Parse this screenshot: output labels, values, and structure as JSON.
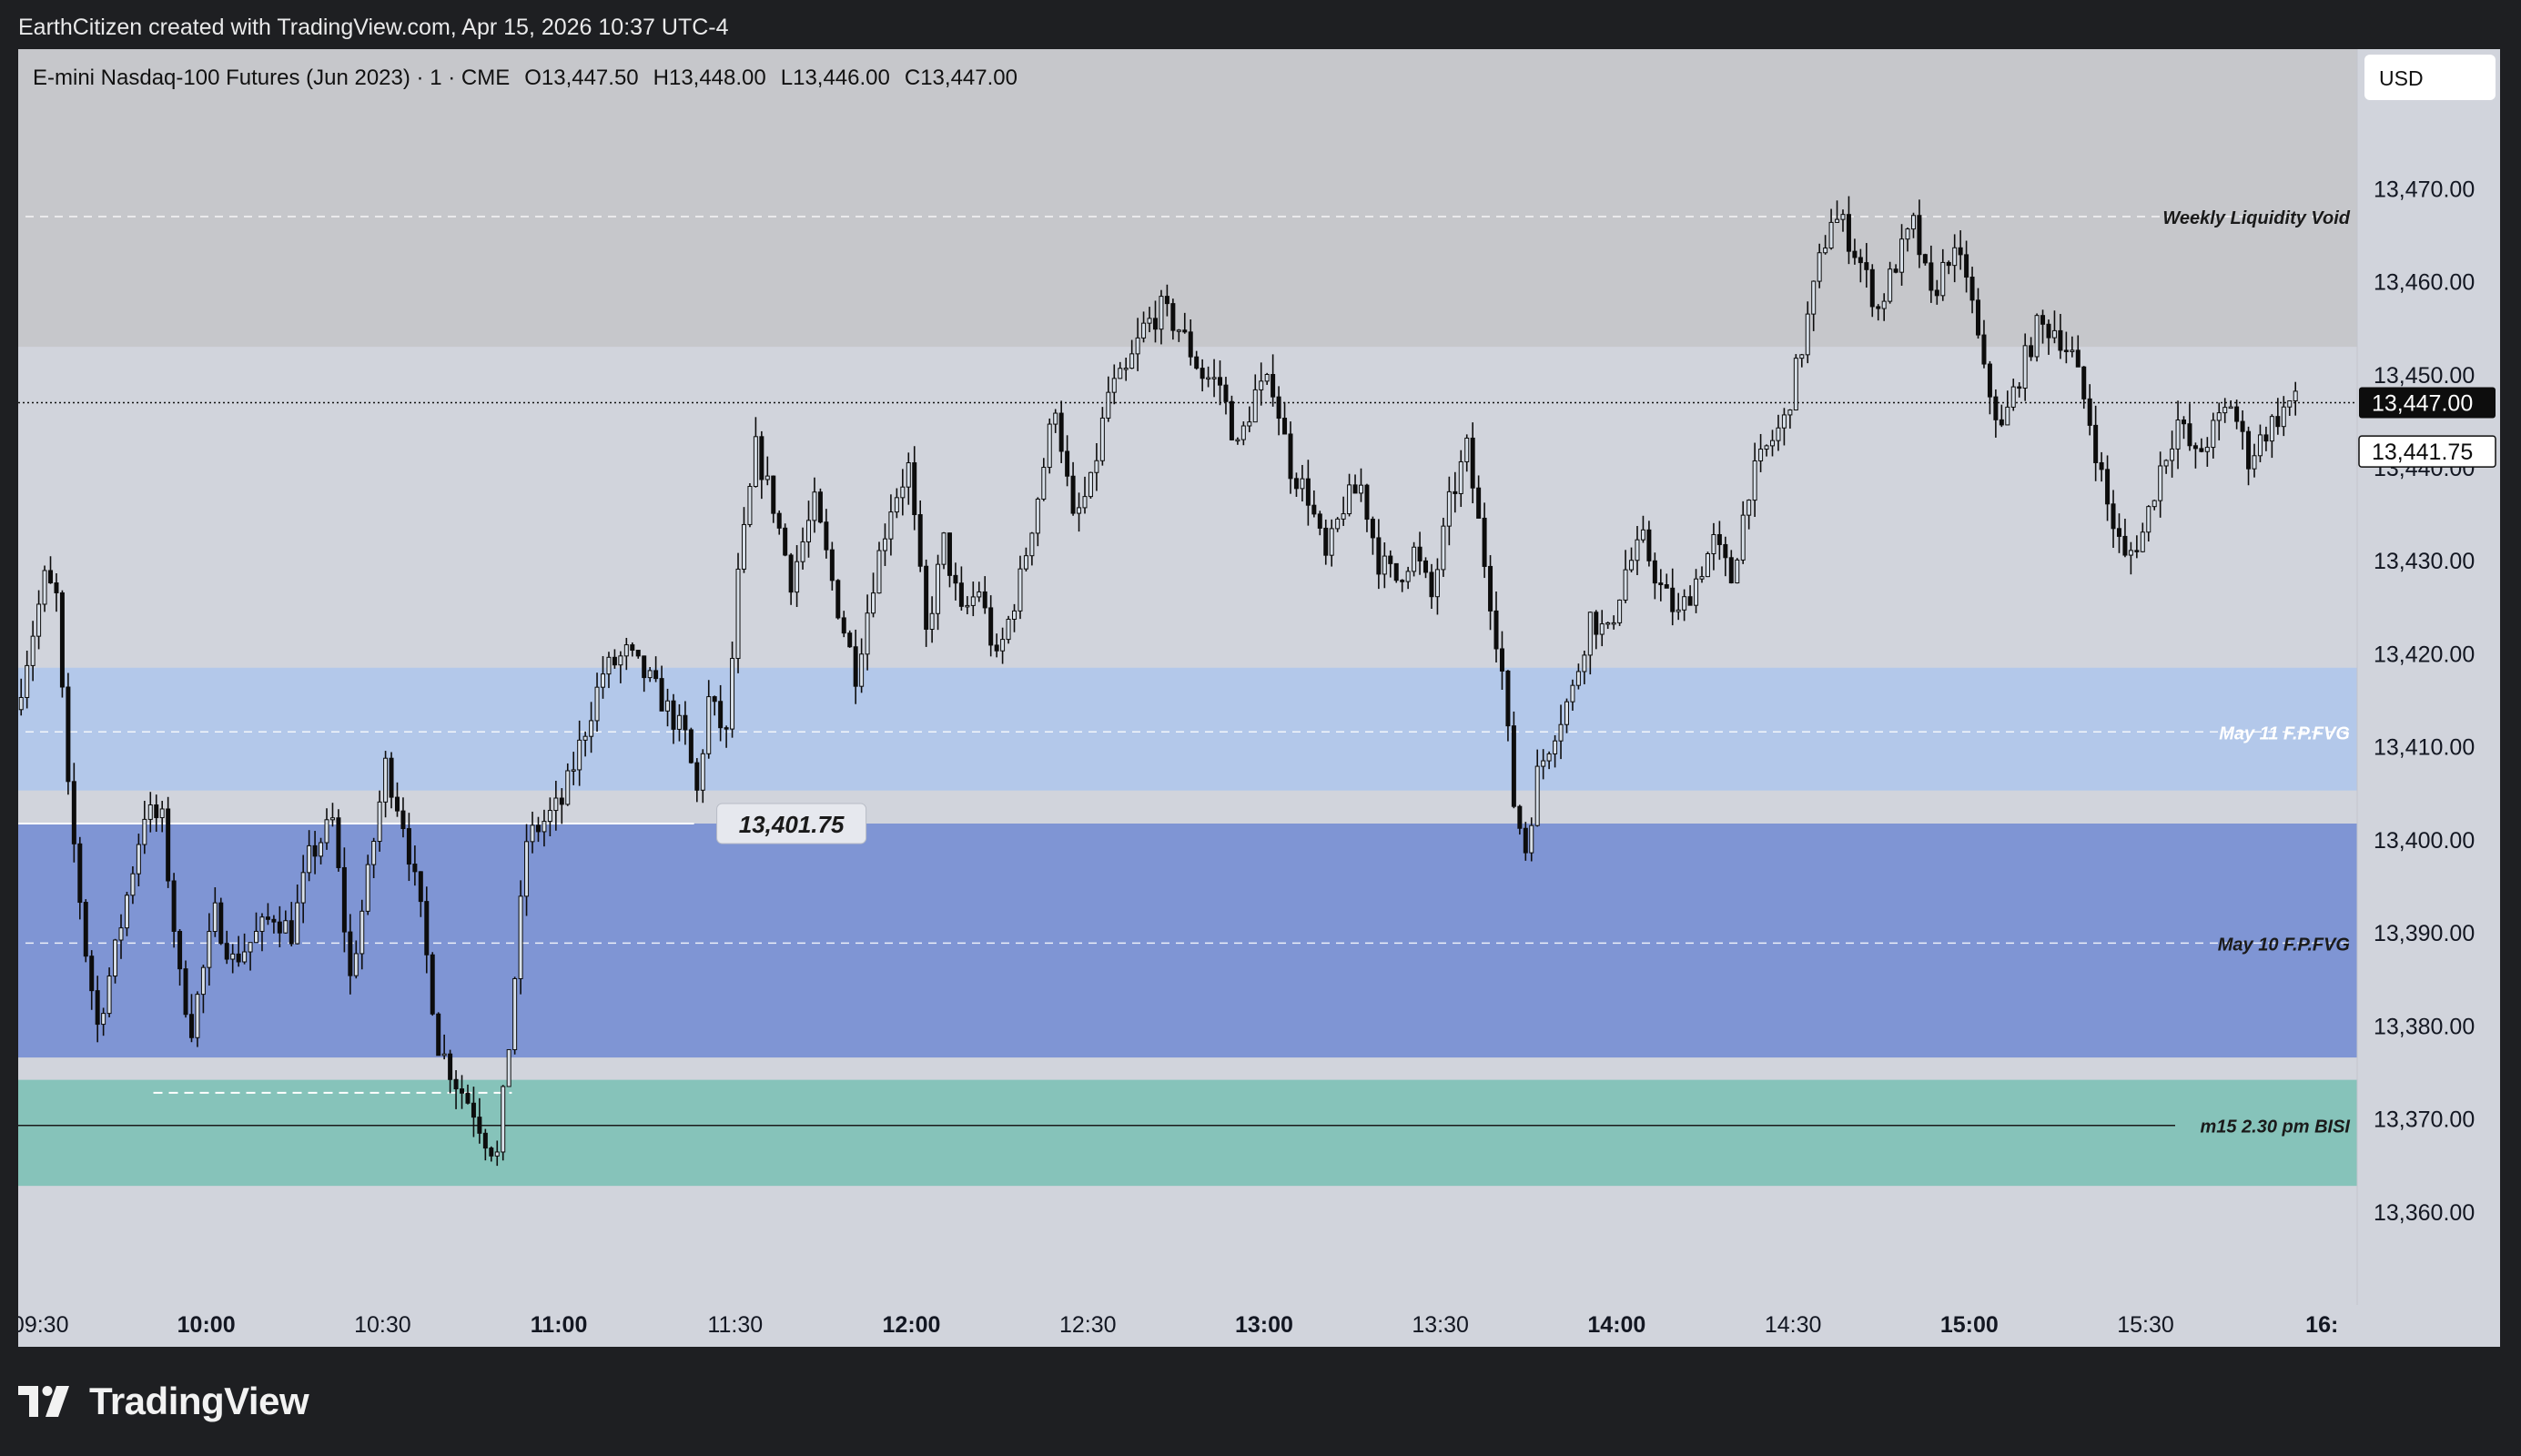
{
  "header": {
    "attribution": "EarthCitizen created with TradingView.com, Apr 15, 2026 10:37 UTC-4"
  },
  "currency_button": {
    "label": "USD"
  },
  "branding": {
    "logo_text": "TradingView",
    "logo_icon": "tradingview-logo-icon"
  },
  "colors": {
    "background": "#d1d4dc",
    "weekly_void_zone": "#c6c7cb",
    "may11_zone": "#b3c8ea",
    "may10_zone": "#7f95d4",
    "bisi_zone": "#86c3ba",
    "candle_up_body": "#d8e0e9",
    "candle_down_body": "#0d0d0d",
    "wick": "#0d0d0d"
  },
  "chart_data": {
    "type": "candlestick",
    "title": "E-mini Nasdaq-100 Futures (Jun 2023) · 1 · CME",
    "ohlc": {
      "O": "O13,447.50",
      "H": "H13,448.00",
      "L": "L13,446.00",
      "C": "C13,447.00"
    },
    "ylim": [
      13350,
      13485
    ],
    "y_ticks": [
      13360,
      13370,
      13380,
      13390,
      13400,
      13410,
      13420,
      13430,
      13440,
      13450,
      13460,
      13470
    ],
    "y_tick_labels": [
      "13,360.00",
      "13,370.00",
      "13,380.00",
      "13,390.00",
      "13,400.00",
      "13,410.00",
      "13,420.00",
      "13,430.00",
      "13,440.00",
      "13,450.00",
      "13,460.00",
      "13,470.00"
    ],
    "x_range_minutes": [
      "09:28",
      "16:06"
    ],
    "x_ticks": [
      {
        "time": "09:30",
        "label": "09:30",
        "bold": false
      },
      {
        "time": "10:00",
        "label": "10:00",
        "bold": true
      },
      {
        "time": "10:30",
        "label": "10:30",
        "bold": false
      },
      {
        "time": "11:00",
        "label": "11:00",
        "bold": true
      },
      {
        "time": "11:30",
        "label": "11:30",
        "bold": false
      },
      {
        "time": "12:00",
        "label": "12:00",
        "bold": true
      },
      {
        "time": "12:30",
        "label": "12:30",
        "bold": false
      },
      {
        "time": "13:00",
        "label": "13:00",
        "bold": true
      },
      {
        "time": "13:30",
        "label": "13:30",
        "bold": false
      },
      {
        "time": "14:00",
        "label": "14:00",
        "bold": true
      },
      {
        "time": "14:30",
        "label": "14:30",
        "bold": false
      },
      {
        "time": "15:00",
        "label": "15:00",
        "bold": true
      },
      {
        "time": "15:30",
        "label": "15:30",
        "bold": false
      },
      {
        "time": "16:00",
        "label": "16:",
        "bold": true
      }
    ],
    "zones": [
      {
        "name": "Weekly Liquidity Void",
        "from": 13453,
        "to": 13490,
        "mid": 13467,
        "color": "#c6c7cb",
        "label_color": "#1a1a1a"
      },
      {
        "name": "May 11 F.P.FVG",
        "from": 13405.3,
        "to": 13418.5,
        "mid": 13411.6,
        "color": "#b3c8ea",
        "label_color": "#ffffff"
      },
      {
        "name": "May 10 F.P.FVG",
        "from": 13376.6,
        "to": 13401.75,
        "mid": 13388.9,
        "color": "#7f95d4",
        "label_color": "#1a1a1a"
      },
      {
        "name": "m15 2.30 pm BISI",
        "from": 13362.8,
        "to": 13374.2,
        "mid": 13369.3,
        "color": "#86c3ba",
        "label_color": "#1a1a1a"
      }
    ],
    "price_lines": [
      {
        "label": "13,401.75",
        "value": 13401.75,
        "from": "09:28",
        "to": "11:23",
        "color": "#ffffff"
      },
      {
        "label": "",
        "value": 13372.8,
        "from": "09:51",
        "to": "10:52",
        "color": "#ffffff",
        "dashed": true
      }
    ],
    "last_price": {
      "label": "13,447.00",
      "value": 13447.0
    },
    "secondary_price": {
      "label": "13,441.75",
      "value": 13441.75
    },
    "bisi_line": 13369.3,
    "keypoints": [
      [
        "09:28",
        13414
      ],
      [
        "09:33",
        13428
      ],
      [
        "09:35",
        13426
      ],
      [
        "09:37",
        13405
      ],
      [
        "09:40",
        13388
      ],
      [
        "09:42",
        13380
      ],
      [
        "09:45",
        13388
      ],
      [
        "09:50",
        13403
      ],
      [
        "09:53",
        13402
      ],
      [
        "09:56",
        13385
      ],
      [
        "09:58",
        13380
      ],
      [
        "10:02",
        13392
      ],
      [
        "10:05",
        13387
      ],
      [
        "10:08",
        13389
      ],
      [
        "10:12",
        13392
      ],
      [
        "10:15",
        13390
      ],
      [
        "10:18",
        13398
      ],
      [
        "10:22",
        13402
      ],
      [
        "10:25",
        13385
      ],
      [
        "10:28",
        13396
      ],
      [
        "10:31",
        13408
      ],
      [
        "10:34",
        13402
      ],
      [
        "10:37",
        13392
      ],
      [
        "10:40",
        13378
      ],
      [
        "10:43",
        13374
      ],
      [
        "10:46",
        13371
      ],
      [
        "10:48",
        13368
      ],
      [
        "10:50",
        13366
      ],
      [
        "10:52",
        13378
      ],
      [
        "10:55",
        13400
      ],
      [
        "10:58",
        13402
      ],
      [
        "11:01",
        13404
      ],
      [
        "11:05",
        13412
      ],
      [
        "11:08",
        13418
      ],
      [
        "11:12",
        13420
      ],
      [
        "11:16",
        13417
      ],
      [
        "11:19",
        13414
      ],
      [
        "11:22",
        13411
      ],
      [
        "11:24",
        13405
      ],
      [
        "11:26",
        13415
      ],
      [
        "11:29",
        13411
      ],
      [
        "11:31",
        13428
      ],
      [
        "11:34",
        13442
      ],
      [
        "11:37",
        13436
      ],
      [
        "11:40",
        13428
      ],
      [
        "11:44",
        13436
      ],
      [
        "11:48",
        13425
      ],
      [
        "11:51",
        13418
      ],
      [
        "11:54",
        13428
      ],
      [
        "11:57",
        13436
      ],
      [
        "12:00",
        13440
      ],
      [
        "12:03",
        13422
      ],
      [
        "12:06",
        13432
      ],
      [
        "12:09",
        13424
      ],
      [
        "12:12",
        13427
      ],
      [
        "12:15",
        13419
      ],
      [
        "12:19",
        13428
      ],
      [
        "12:22",
        13437
      ],
      [
        "12:25",
        13447
      ],
      [
        "12:28",
        13434
      ],
      [
        "12:31",
        13438
      ],
      [
        "12:34",
        13448
      ],
      [
        "12:37",
        13450
      ],
      [
        "12:40",
        13455
      ],
      [
        "12:43",
        13457
      ],
      [
        "12:46",
        13455
      ],
      [
        "12:50",
        13450
      ],
      [
        "12:53",
        13449
      ],
      [
        "12:56",
        13442
      ],
      [
        "12:59",
        13448
      ],
      [
        "13:02",
        13449
      ],
      [
        "13:05",
        13440
      ],
      [
        "13:08",
        13437
      ],
      [
        "13:11",
        13430
      ],
      [
        "13:14",
        13436
      ],
      [
        "13:17",
        13438
      ],
      [
        "13:20",
        13430
      ],
      [
        "13:23",
        13428
      ],
      [
        "13:26",
        13431
      ],
      [
        "13:29",
        13426
      ],
      [
        "13:32",
        13436
      ],
      [
        "13:35",
        13442
      ],
      [
        "13:38",
        13430
      ],
      [
        "13:41",
        13418
      ],
      [
        "13:43",
        13404
      ],
      [
        "13:45",
        13399
      ],
      [
        "13:47",
        13407
      ],
      [
        "13:50",
        13412
      ],
      [
        "13:53",
        13416
      ],
      [
        "13:56",
        13424
      ],
      [
        "13:59",
        13422
      ],
      [
        "14:02",
        13429
      ],
      [
        "14:05",
        13432
      ],
      [
        "14:08",
        13427
      ],
      [
        "14:11",
        13424
      ],
      [
        "14:14",
        13428
      ],
      [
        "14:17",
        13432
      ],
      [
        "14:20",
        13428
      ],
      [
        "14:23",
        13438
      ],
      [
        "14:26",
        13442
      ],
      [
        "14:29",
        13445
      ],
      [
        "14:32",
        13453
      ],
      [
        "14:35",
        13462
      ],
      [
        "14:37",
        13467
      ],
      [
        "14:39",
        13466
      ],
      [
        "14:42",
        13462
      ],
      [
        "14:45",
        13457
      ],
      [
        "14:48",
        13462
      ],
      [
        "14:51",
        13466
      ],
      [
        "14:54",
        13458
      ],
      [
        "14:57",
        13463
      ],
      [
        "15:00",
        13461
      ],
      [
        "15:03",
        13450
      ],
      [
        "15:06",
        13444
      ],
      [
        "15:09",
        13450
      ],
      [
        "15:12",
        13455
      ],
      [
        "15:15",
        13455
      ],
      [
        "15:18",
        13452
      ],
      [
        "15:21",
        13445
      ],
      [
        "15:24",
        13436
      ],
      [
        "15:27",
        13430
      ],
      [
        "15:30",
        13433
      ],
      [
        "15:33",
        13440
      ],
      [
        "15:36",
        13445
      ],
      [
        "15:39",
        13441
      ],
      [
        "15:42",
        13444
      ],
      [
        "15:45",
        13447
      ],
      [
        "15:48",
        13441
      ],
      [
        "15:51",
        13444
      ],
      [
        "15:55",
        13447
      ]
    ]
  }
}
